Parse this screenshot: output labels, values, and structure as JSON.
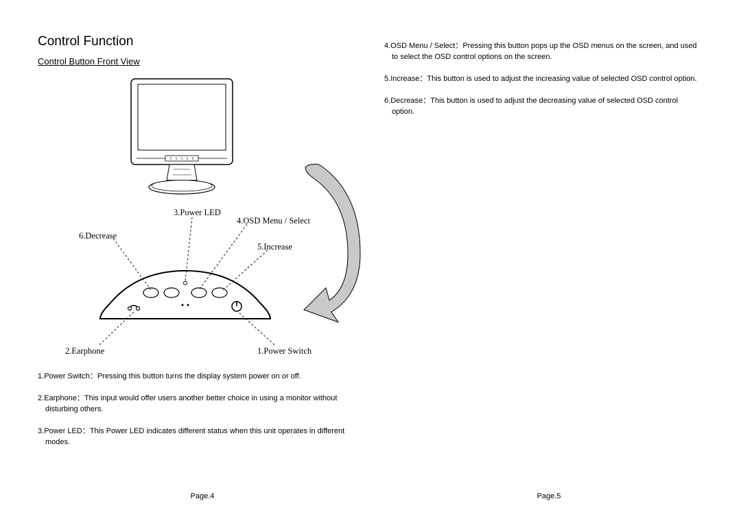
{
  "title": "Control Function",
  "subtitle": "Control Button Front View",
  "callouts": {
    "c3": "3.Power LED",
    "c4": "4.OSD Menu / Select",
    "c5": "5.Increase",
    "c6": "6.Decrease",
    "c2": "2.Earphone",
    "c1": "1.Power Switch"
  },
  "left_items": [
    {
      "num": "1.",
      "name": "Power Switch",
      "text": "Pressing this button turns the display system power on or off."
    },
    {
      "num": "2.",
      "name": "Earphone",
      "text": "This input would offer users another better choice in using a monitor without disturbing others."
    },
    {
      "num": "3.",
      "name": "Power LED",
      "text": "This Power LED indicates different status when this unit operates in different modes."
    }
  ],
  "right_items": [
    {
      "num": "4.",
      "name": "OSD Menu / Select",
      "text": "Pressing this button pops up the OSD menus on the screen, and used to select the OSD control options on the screen."
    },
    {
      "num": "5.",
      "name": "Increase",
      "text": "This button is used to adjust the increasing value of selected OSD control option."
    },
    {
      "num": "6.",
      "name": "Decrease",
      "text": "This button is used to adjust the decreasing value of selected OSD control option."
    }
  ],
  "page_left": "Page.4",
  "page_right": "Page.5",
  "colon": "："
}
